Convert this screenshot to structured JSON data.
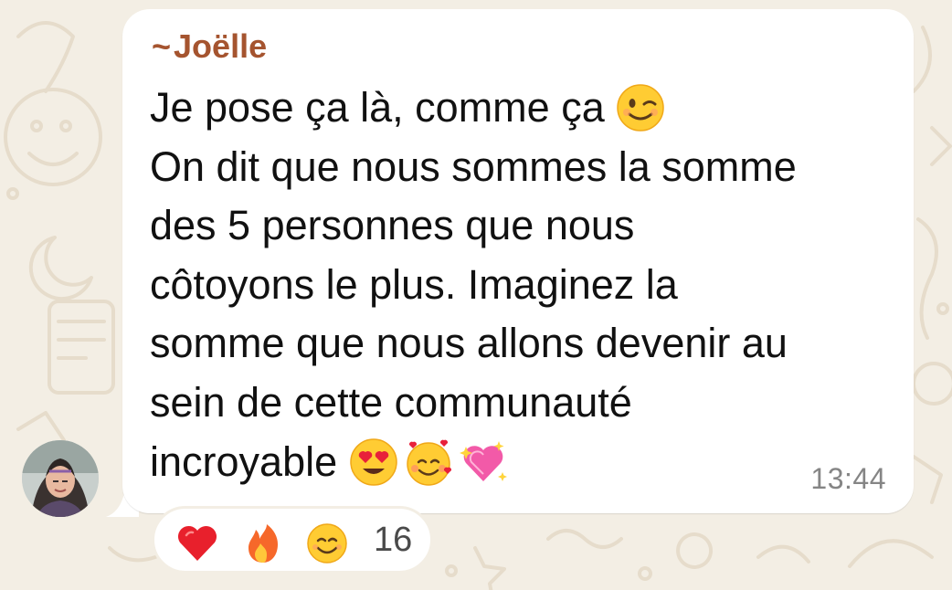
{
  "chat": {
    "sender_name": "Joëlle",
    "sender_prefix": "~",
    "message_lines": [
      "Je pose ça là, comme ça",
      "On dit que nous sommes la somme",
      "des 5 personnes que nous",
      "côtoyons le plus. Imaginez la",
      "somme que nous allons devenir au",
      "sein de cette communauté",
      "incroyable"
    ],
    "timestamp": "13:44",
    "inline_emojis": {
      "line1": "winking-face-icon",
      "line7": [
        "heart-eyes-face-icon",
        "smiling-face-with-hearts-icon",
        "sparkling-heart-icon"
      ]
    }
  },
  "reactions": {
    "emojis": [
      "red-heart-icon",
      "fire-icon",
      "smiling-face-icon"
    ],
    "count": "16"
  },
  "colors": {
    "sender": "#a5542f",
    "bubble": "#ffffff",
    "wallpaper": "#f3eee4",
    "timestamp": "#858585"
  }
}
